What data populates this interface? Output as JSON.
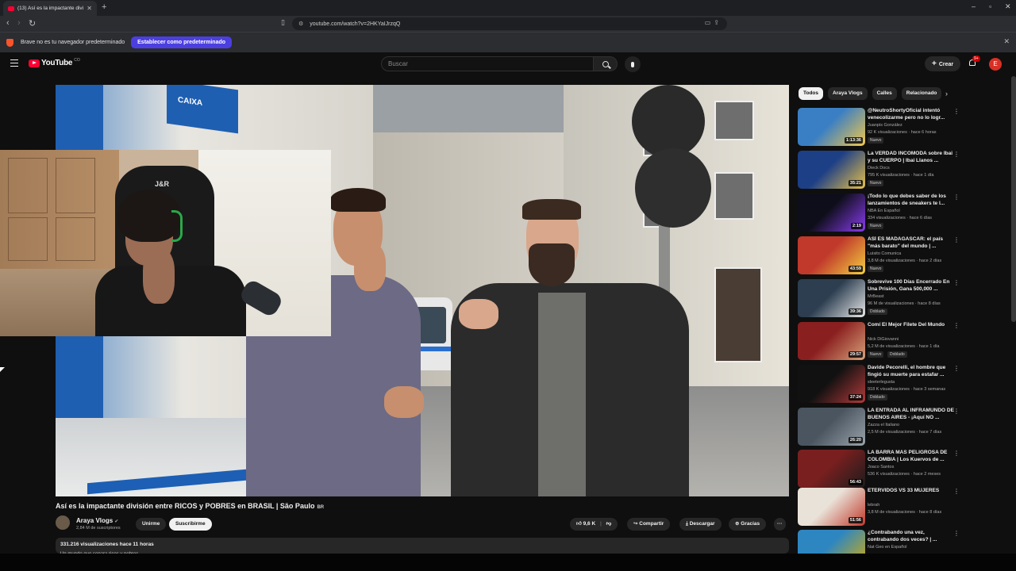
{
  "browser": {
    "tab_title": "(13) Así es la impactante divi...",
    "new_tab": "+",
    "url": "youtube.com/watch?v=2HKYaIJrzqQ",
    "infobar_text": "Brave no es tu navegador predeterminado",
    "infobar_button": "Establecer como predeterminado",
    "close": "✕",
    "minimize": "–",
    "maximize": "▫",
    "back": "‹",
    "forward": "›",
    "reload": "↻"
  },
  "youtube": {
    "logo_text": "YouTube",
    "logo_country": "CO",
    "search_placeholder": "Buscar",
    "create_label": "Crear",
    "notif_count": "9+",
    "avatar_letter": "E"
  },
  "player": {
    "sign_text": "CAIXA",
    "chair_logo": "J&R"
  },
  "video": {
    "title": "Así es la impactante división entre RICOS y POBRES en BRASIL | São Paulo",
    "title_badge": "BR",
    "channel": "Araya Vlogs",
    "subscribers": "2,84 M de suscriptores",
    "join": "Unirme",
    "subscribe": "Suscribirme",
    "likes": "9,6 K",
    "share": "Compartir",
    "download": "Descargar",
    "thanks": "Gracias",
    "more": "···",
    "views_time": "331.216 visualizaciones  hace 11 horas",
    "desc_preview": "Un mundo que separa ricos y pobres"
  },
  "sidebar": {
    "chips": [
      "Todos",
      "Araya Vlogs",
      "Calles",
      "Relacionado"
    ],
    "recommendations": [
      {
        "title": "@NeutroShortyOficial intentó venecolizarme pero no lo logr...",
        "channel": "Juanpis González",
        "meta": "92 K visualizaciones · hace 6 horas",
        "duration": "1:13:36",
        "tags": [
          "Nuevo"
        ],
        "color1": "#3a7fc4",
        "color2": "#f2c84b"
      },
      {
        "title": "La VERDAD INCÓMODA sobre Ibai y su CUERPO | Ibai Llanos ...",
        "channel": "Dieck Docs",
        "meta": "795 K visualizaciones · hace 1 día",
        "duration": "35:21",
        "tags": [
          "Nuevo"
        ],
        "color1": "#1d3f86",
        "color2": "#e7c14a"
      },
      {
        "title": "¡Todo lo que debes saber de los lanzamientos de sneakers te l...",
        "channel": "NBA En Español",
        "meta": "334 visualizaciones · hace 6 días",
        "duration": "2:19",
        "tags": [
          "Nuevo"
        ],
        "color1": "#0e0e1a",
        "color2": "#8b3cf0"
      },
      {
        "title": "ASÍ ES MADAGASCAR: el país \"más barato\" del mundo | ...",
        "channel": "Luisito Comunica",
        "meta": "3,8 M de visualizaciones · hace 2 días",
        "duration": "43:59",
        "tags": [
          "Nuevo"
        ],
        "color1": "#c0392b",
        "color2": "#f4d03f"
      },
      {
        "title": "Sobrevive 100 Días Encerrado En Una Prisión, Gana 500,000 ...",
        "channel": "MrBeast",
        "meta": "96 M de visualizaciones · hace 8 días",
        "duration": "39:36",
        "tags": [
          "Doblado"
        ],
        "color1": "#2c3e50",
        "color2": "#e8e8e8"
      },
      {
        "title": "Comí El Mejor Filete Del Mundo",
        "channel": "Nick DiGiovanni",
        "meta": "5,2 M de visualizaciones · hace 1 día",
        "duration": "29:57",
        "tags": [
          "Nuevo",
          "Doblado"
        ],
        "color1": "#8a1f1f",
        "color2": "#d9a27a"
      },
      {
        "title": "Davide Pecorelli, el hombre que fingió su muerte para estafar ...",
        "channel": "sleeterlegusta",
        "meta": "918 K visualizaciones · hace 3 semanas",
        "duration": "37:24",
        "tags": [
          "Doblado"
        ],
        "color1": "#111111",
        "color2": "#b33a3a"
      },
      {
        "title": "LA ENTRADA AL INFRAMUNDO DE BUENOS AIRES - ¡Aquí NO ...",
        "channel": "Zazza el Italiano",
        "meta": "2,5 M de visualizaciones · hace 7 días",
        "duration": "26:20",
        "tags": [],
        "color1": "#4a5560",
        "color2": "#9aa3ab"
      },
      {
        "title": "LA BARRA MAS PELIGROSA DE COLOMBIA | Los Kuervos de ...",
        "channel": "Joaco Santos",
        "meta": "536 K visualizaciones · hace 2 meses",
        "duration": "56:43",
        "tags": [],
        "color1": "#7a1f1f",
        "color2": "#1c1c1c"
      },
      {
        "title": "ETERVIDOS VS 33 MUJERES",
        "channel": "lebrah",
        "meta": "3,8 M de visualizaciones · hace 8 días",
        "duration": "51:56",
        "tags": [],
        "color1": "#e9e2d8",
        "color2": "#c0392b"
      },
      {
        "title": "¿Contrabando una vez, contrabando dos veces? | ...",
        "channel": "Nat Geo en Español",
        "meta": "",
        "duration": "",
        "tags": [],
        "color1": "#2e86c1",
        "color2": "#d4ac0d"
      }
    ]
  }
}
